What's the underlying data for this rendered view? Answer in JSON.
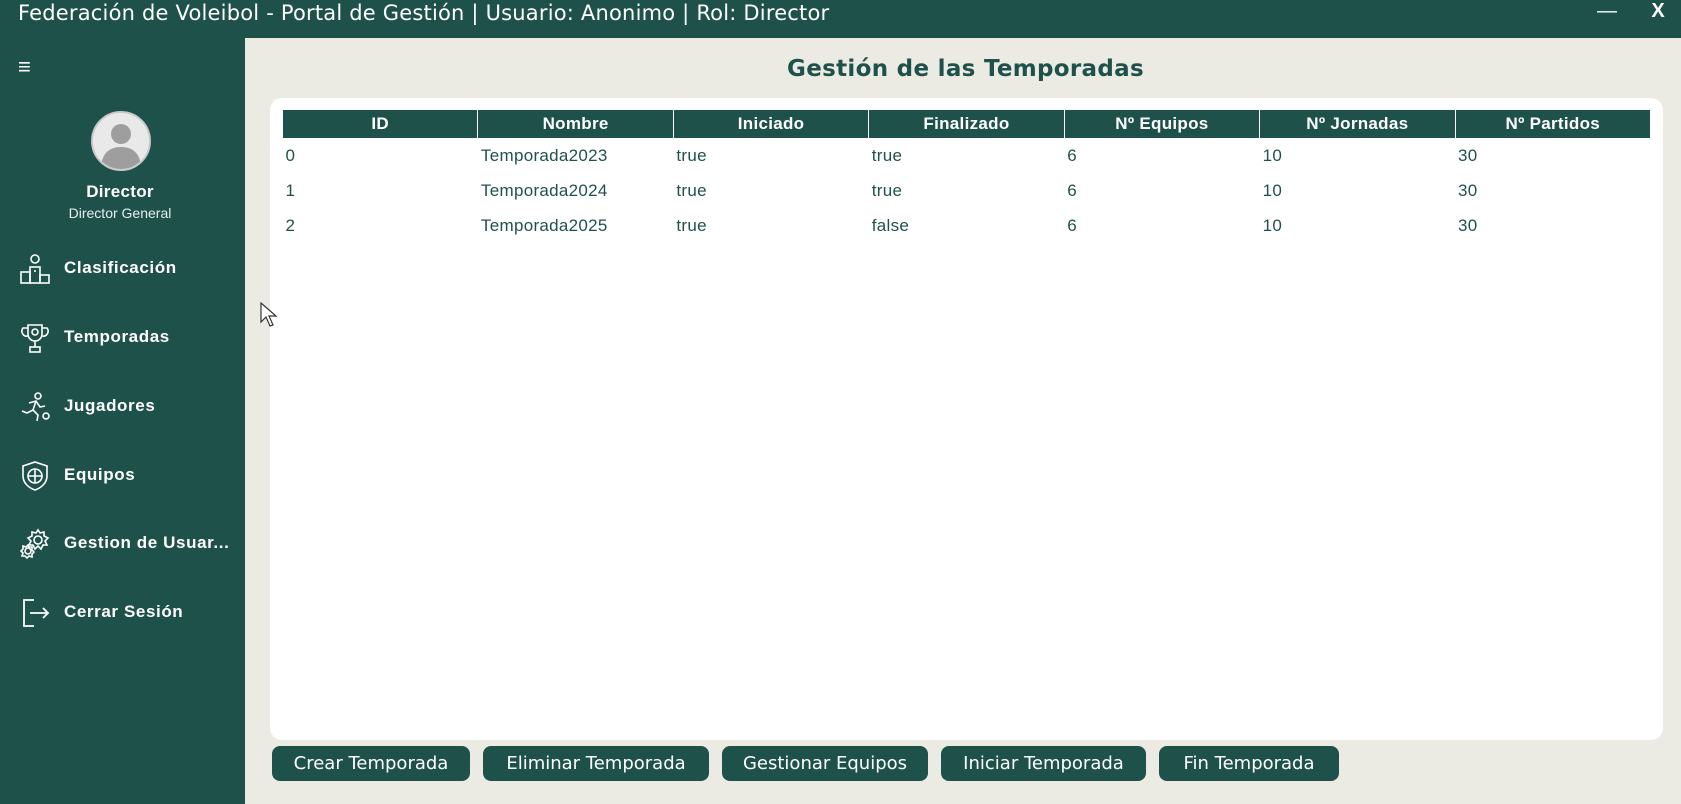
{
  "window": {
    "title": "Federación de Voleibol - Portal de Gestión | Usuario: Anonimo | Rol: Director",
    "minimize_label": "—",
    "close_label": "X"
  },
  "colors": {
    "primary": "#1f514b",
    "background": "#ebebe3",
    "panel": "#ffffff"
  },
  "sidebar": {
    "menu_icon": "≡",
    "profile": {
      "name": "Director",
      "role": "Director General"
    },
    "items": [
      {
        "label": "Clasificación",
        "icon": "podium-icon"
      },
      {
        "label": "Temporadas",
        "icon": "trophy-icon"
      },
      {
        "label": "Jugadores",
        "icon": "player-kick-icon"
      },
      {
        "label": "Equipos",
        "icon": "team-badge-icon"
      },
      {
        "label": "Gestion de Usuar...",
        "icon": "gear-users-icon"
      },
      {
        "label": "Cerrar Sesión",
        "icon": "logout-icon"
      }
    ]
  },
  "main": {
    "title": "Gestión de las Temporadas",
    "table": {
      "columns": [
        "ID",
        "Nombre",
        "Iniciado",
        "Finalizado",
        "Nº Equipos",
        "Nº Jornadas",
        "Nº Partidos"
      ],
      "rows": [
        [
          "0",
          "Temporada2023",
          "true",
          "true",
          "6",
          "10",
          "30"
        ],
        [
          "1",
          "Temporada2024",
          "true",
          "true",
          "6",
          "10",
          "30"
        ],
        [
          "2",
          "Temporada2025",
          "true",
          "false",
          "6",
          "10",
          "30"
        ]
      ]
    },
    "actions": {
      "create": "Crear Temporada",
      "delete": "Eliminar Temporada",
      "manage_teams": "Gestionar Equipos",
      "start": "Iniciar Temporada",
      "end": "Fin Temporada"
    }
  }
}
